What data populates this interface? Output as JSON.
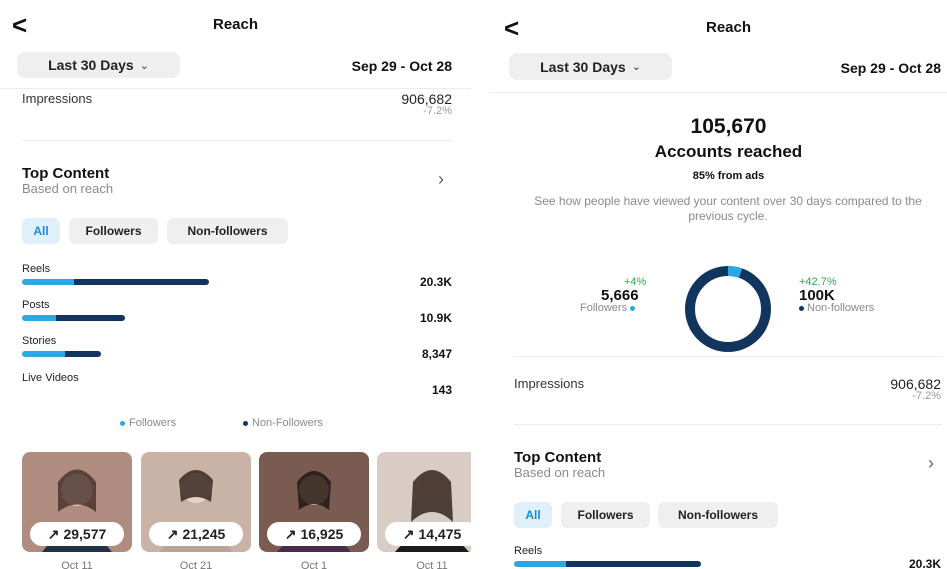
{
  "left": {
    "header": {
      "back_icon": "chevron-left-icon",
      "back_glyph": "<",
      "title": "Reach"
    },
    "filter": {
      "range_label": "Last 30 Days",
      "date_range": "Sep 29 - Oct 28"
    },
    "impressions": {
      "label": "Impressions",
      "value": "906,682",
      "delta": "-7.2%"
    },
    "top_content": {
      "title": "Top Content",
      "subtitle": "Based on reach",
      "tabs": [
        {
          "label": "All",
          "active": true
        },
        {
          "label": "Followers",
          "active": false
        },
        {
          "label": "Non-followers",
          "active": false
        }
      ],
      "categories": [
        {
          "label": "Reels",
          "value": "20.3K",
          "followers_pct": 0.28,
          "nonfollowers_pct": 0.72,
          "total_fraction": 1.0
        },
        {
          "label": "Posts",
          "value": "10.9K",
          "followers_pct": 0.33,
          "nonfollowers_pct": 0.67,
          "total_fraction": 0.55
        },
        {
          "label": "Stories",
          "value": "8,347",
          "followers_pct": 0.55,
          "nonfollowers_pct": 0.45,
          "total_fraction": 0.42
        },
        {
          "label": "Live Videos",
          "value": "143",
          "followers_pct": 0,
          "nonfollowers_pct": 0,
          "total_fraction": 0
        }
      ],
      "legend": {
        "followers": "Followers",
        "nonfollowers": "Non-Followers"
      },
      "thumbnails": [
        {
          "value": "29,577",
          "date": "Oct 11",
          "bg": "#b08c80"
        },
        {
          "value": "21,245",
          "date": "Oct 21",
          "bg": "#c9b3a6"
        },
        {
          "value": "16,925",
          "date": "Oct 1",
          "bg": "#7a5b52"
        },
        {
          "value": "14,475",
          "date": "Oct 11",
          "bg": "#d8ccc4"
        }
      ],
      "trend_glyph": "↗"
    }
  },
  "right": {
    "header": {
      "back_icon": "chevron-left-icon",
      "back_glyph": "<",
      "title": "Reach"
    },
    "filter": {
      "range_label": "Last 30 Days",
      "date_range": "Sep 29 - Oct 28"
    },
    "summary": {
      "accounts_value": "105,670",
      "accounts_label": "Accounts reached",
      "ads_note": "85% from ads",
      "description": "See how people have viewed your content over 30 days compared to the previous cycle."
    },
    "donut": {
      "followers": {
        "delta": "+4%",
        "value": "5,666",
        "label": "Followers"
      },
      "nonfollowers": {
        "delta": "+42.7%",
        "value": "100K",
        "label": "Non-followers"
      },
      "followers_share": 0.054
    },
    "impressions": {
      "label": "Impressions",
      "value": "906,682",
      "delta": "-7.2%"
    },
    "top_content": {
      "title": "Top Content",
      "subtitle": "Based on reach",
      "tabs": [
        {
          "label": "All",
          "active": true
        },
        {
          "label": "Followers",
          "active": false
        },
        {
          "label": "Non-followers",
          "active": false
        }
      ],
      "categories": [
        {
          "label": "Reels",
          "value": "20.3K",
          "followers_pct": 0.28,
          "nonfollowers_pct": 0.72,
          "total_fraction": 1.0
        }
      ]
    }
  },
  "colors": {
    "followers": "#2aa7e4",
    "nonfollowers": "#12355f",
    "positive": "#2fa84f",
    "chip_active_bg": "#e0f0fb",
    "chip_active_text": "#1c8ad6"
  },
  "icons": {
    "chevron_down": "chevron-down-icon",
    "chevron_right": "chevron-right-icon",
    "trend": "trend-up-icon"
  }
}
